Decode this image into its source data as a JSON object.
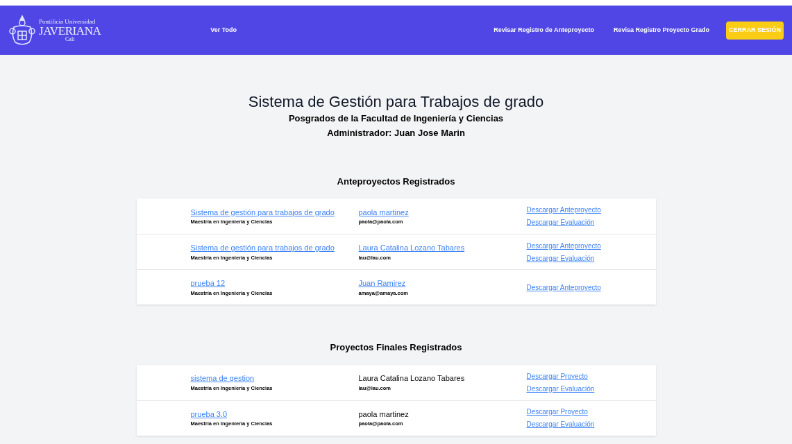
{
  "nav": {
    "logo": {
      "line1": "Pontificia Universidad",
      "line2": "JAVERIANA",
      "line3": "Cali"
    },
    "links": [
      {
        "label": "Ver Todo"
      },
      {
        "label": "Revisar Registro de Anteproyecto"
      },
      {
        "label": "Revisa Registro Proyecto Grado"
      }
    ],
    "logout": "CERRAR SESIÓN"
  },
  "header": {
    "title": "Sistema de Gestión para Trabajos de grado",
    "subtitle": "Posgrados de la Facultad de Ingeniería y Ciencias",
    "admin": "Administrador: Juan Jose Marin"
  },
  "sections": [
    {
      "heading": "Anteproyectos Registrados",
      "rows": [
        {
          "title": "Sistema de gestión para trabajos de grado",
          "program": "Maestría en Ingeniería y Ciencias",
          "person": "paola martinez",
          "person_link": true,
          "email": "paola@paola.com",
          "downloads": [
            "Descargar Anteproyecto",
            "Descargar Evaluación"
          ]
        },
        {
          "title": "Sistema de gestión para trabajos de grado",
          "program": "Maestría en Ingeniería y Ciencias",
          "person": "Laura Catalina Lozano Tabares",
          "person_link": true,
          "email": "lau@lau.com",
          "downloads": [
            "Descargar Anteproyecto",
            "Descargar Evaluación"
          ]
        },
        {
          "title": "prueba 12",
          "program": "Maestría en Ingeniería y Ciencias",
          "person": "Juan Ramirez",
          "person_link": true,
          "email": "amaya@amaya.com",
          "downloads": [
            "Descargar Anteproyecto"
          ]
        }
      ]
    },
    {
      "heading": "Proyectos Finales Registrados",
      "rows": [
        {
          "title": "sistema de gestion",
          "program": "Maestría en Ingeniería y Ciencias",
          "person": "Laura Catalina Lozano Tabares",
          "person_link": false,
          "email": "lau@lau.com",
          "downloads": [
            "Descargar Proyecto",
            "Descargar Evaluación"
          ]
        },
        {
          "title": "prueba 3.0",
          "program": "Maestría en Ingeniería y Ciencias",
          "person": "paola martinez",
          "person_link": false,
          "email": "paola@paola.com",
          "downloads": [
            "Descargar Proyecto",
            "Descargar Evaluación"
          ]
        }
      ]
    }
  ]
}
